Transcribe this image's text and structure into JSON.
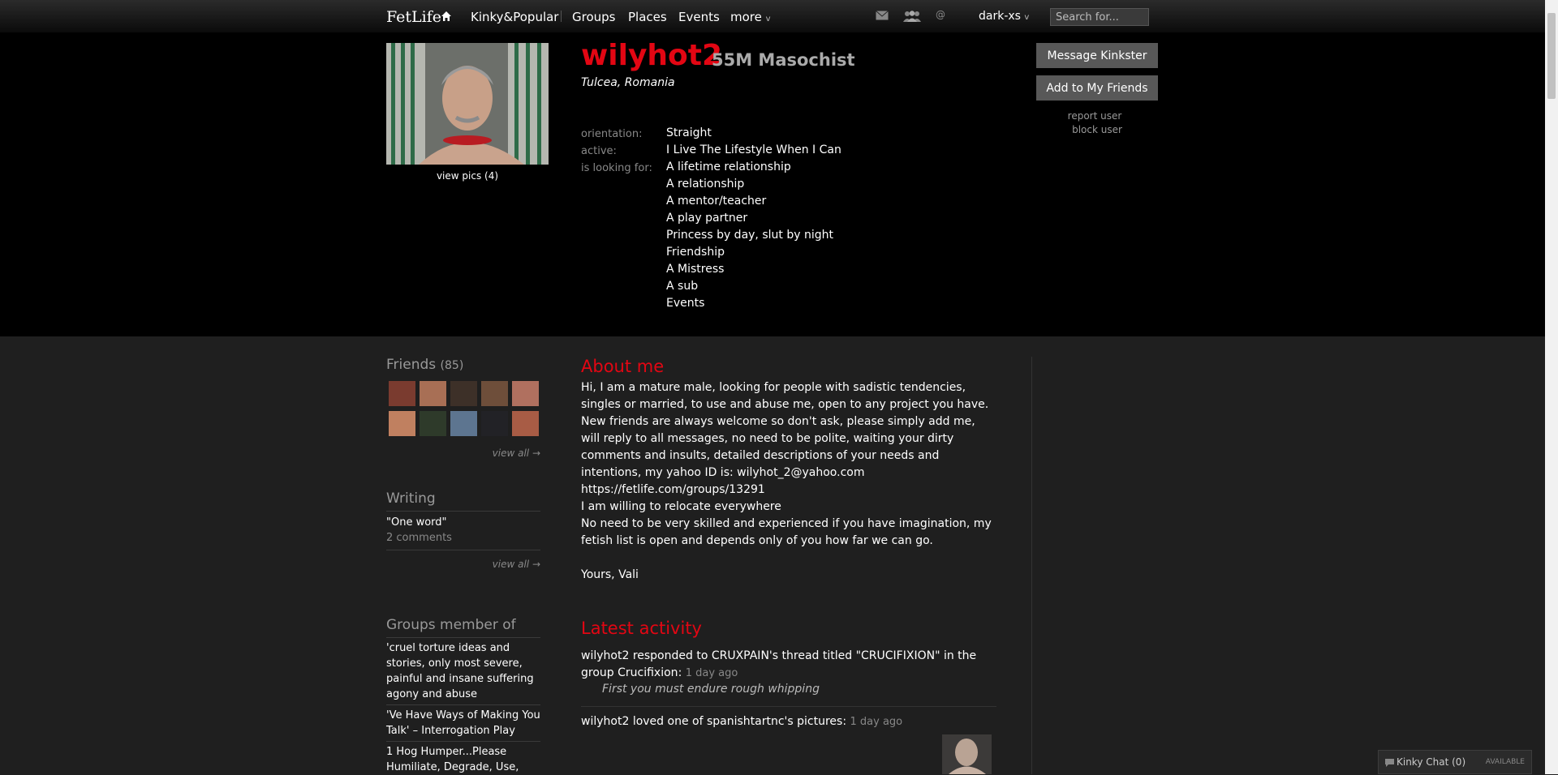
{
  "nav": {
    "logo": "FetLife",
    "links": [
      "Kinky&Popular",
      "Groups",
      "Places",
      "Events",
      "more"
    ],
    "username": "dark-xs",
    "search_placeholder": "Search for..."
  },
  "profile": {
    "name": "wilyhot2",
    "age_sex_role": "55M Masochist",
    "city": "Tulcea",
    "country": "Romania",
    "view_pics": "view pics",
    "pic_count": "(4)",
    "orientation_label": "orientation:",
    "orientation": "Straight",
    "active_label": "active:",
    "active": "I Live The Lifestyle When I Can",
    "looking_label": "is looking for:",
    "looking_for": [
      "A lifetime relationship",
      "A relationship",
      "A mentor/teacher",
      "A play partner",
      "Princess by day, slut by night",
      "Friendship",
      "A Mistress",
      "A sub",
      "Events"
    ]
  },
  "actions": {
    "message": "Message Kinkster",
    "add_friend": "Add to My Friends",
    "report": "report user",
    "block": "block user"
  },
  "sidebar": {
    "friends_title": "Friends",
    "friends_count": "(85)",
    "view_all": "view all →",
    "writing_title": "Writing",
    "writing_item": "\"One word\"",
    "writing_comments": "2 comments",
    "groups_title": "Groups member of",
    "groups": [
      "'cruel torture ideas and stories, only most severe, painful and insane suffering agony and abuse",
      "'Ve Have Ways of Making You Talk' – Interrogation Play",
      "1 Hog Humper...Please Humiliate, Degrade, Use,"
    ]
  },
  "about": {
    "title": "About me",
    "para1": "Hi, I am a mature male, looking for people with sadistic tendencies, singles or married, to use and abuse me, open to any project you have. New friends are always welcome so don't ask, please simply add me, will reply to all messages, no need to be polite, waiting your dirty comments and insults, detailed descriptions of your needs and intentions, my yahoo ID is: wilyhot_2@yahoo.com",
    "link": "https://fetlife.com/groups/13291",
    "line2": "I am willing to relocate everywhere",
    "line3": "No need to be very skilled and experienced if you have imagination, my fetish list is open and depends only of you how far we can go.",
    "sign": "Yours, Vali"
  },
  "activity": {
    "title": "Latest activity",
    "a1_actor": "wilyhot2",
    "a1_t1": "responded to",
    "a1_user": "CRUXPAIN",
    "a1_t2": "'s thread titled",
    "a1_thread": "\"CRUCIFIXION\"",
    "a1_t3": "in the group",
    "a1_group": "Crucifixion",
    "a1_time": "1 day ago",
    "a1_quote": "First you must endure rough whipping",
    "a2_actor": "wilyhot2",
    "a2_t1": "loved one of",
    "a2_user": "spanishtartnc",
    "a2_t2": "'s pictures:",
    "a2_time": "1 day ago"
  },
  "chat": {
    "label": "Kinky Chat",
    "count": "(0)",
    "status": "AVAILABLE"
  },
  "colors": {
    "accent_red": "#e30613",
    "header_bg": "#000000",
    "body_bg": "#1f1f1f",
    "button_bg": "#585858"
  },
  "icons": [
    "home-icon",
    "mail-icon",
    "friends-icon",
    "at-icon",
    "chat-icon"
  ]
}
